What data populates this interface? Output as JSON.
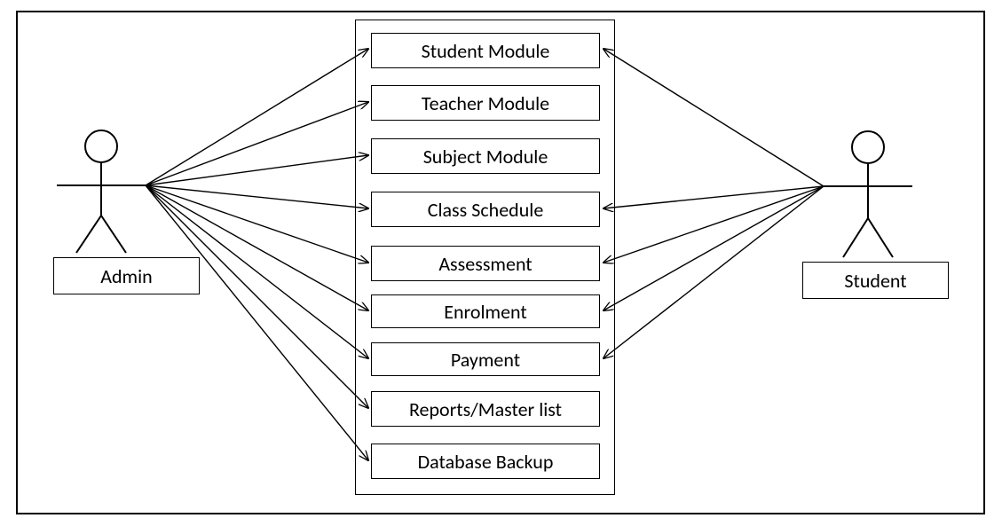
{
  "diagram": {
    "actors": {
      "admin": {
        "label": "Admin"
      },
      "student": {
        "label": "Student"
      }
    },
    "modules": [
      {
        "label": "Student Module"
      },
      {
        "label": "Teacher Module"
      },
      {
        "label": "Subject Module"
      },
      {
        "label": "Class Schedule"
      },
      {
        "label": "Assessment"
      },
      {
        "label": "Enrolment"
      },
      {
        "label": "Payment"
      },
      {
        "label": "Reports/Master list"
      },
      {
        "label": "Database Backup"
      }
    ],
    "admin_links_to": [
      "Student Module",
      "Teacher Module",
      "Subject Module",
      "Class Schedule",
      "Assessment",
      "Enrolment",
      "Payment",
      "Reports/Master list",
      "Database Backup"
    ],
    "student_links_to": [
      "Student Module",
      "Class Schedule",
      "Assessment",
      "Enrolment",
      "Payment"
    ]
  }
}
